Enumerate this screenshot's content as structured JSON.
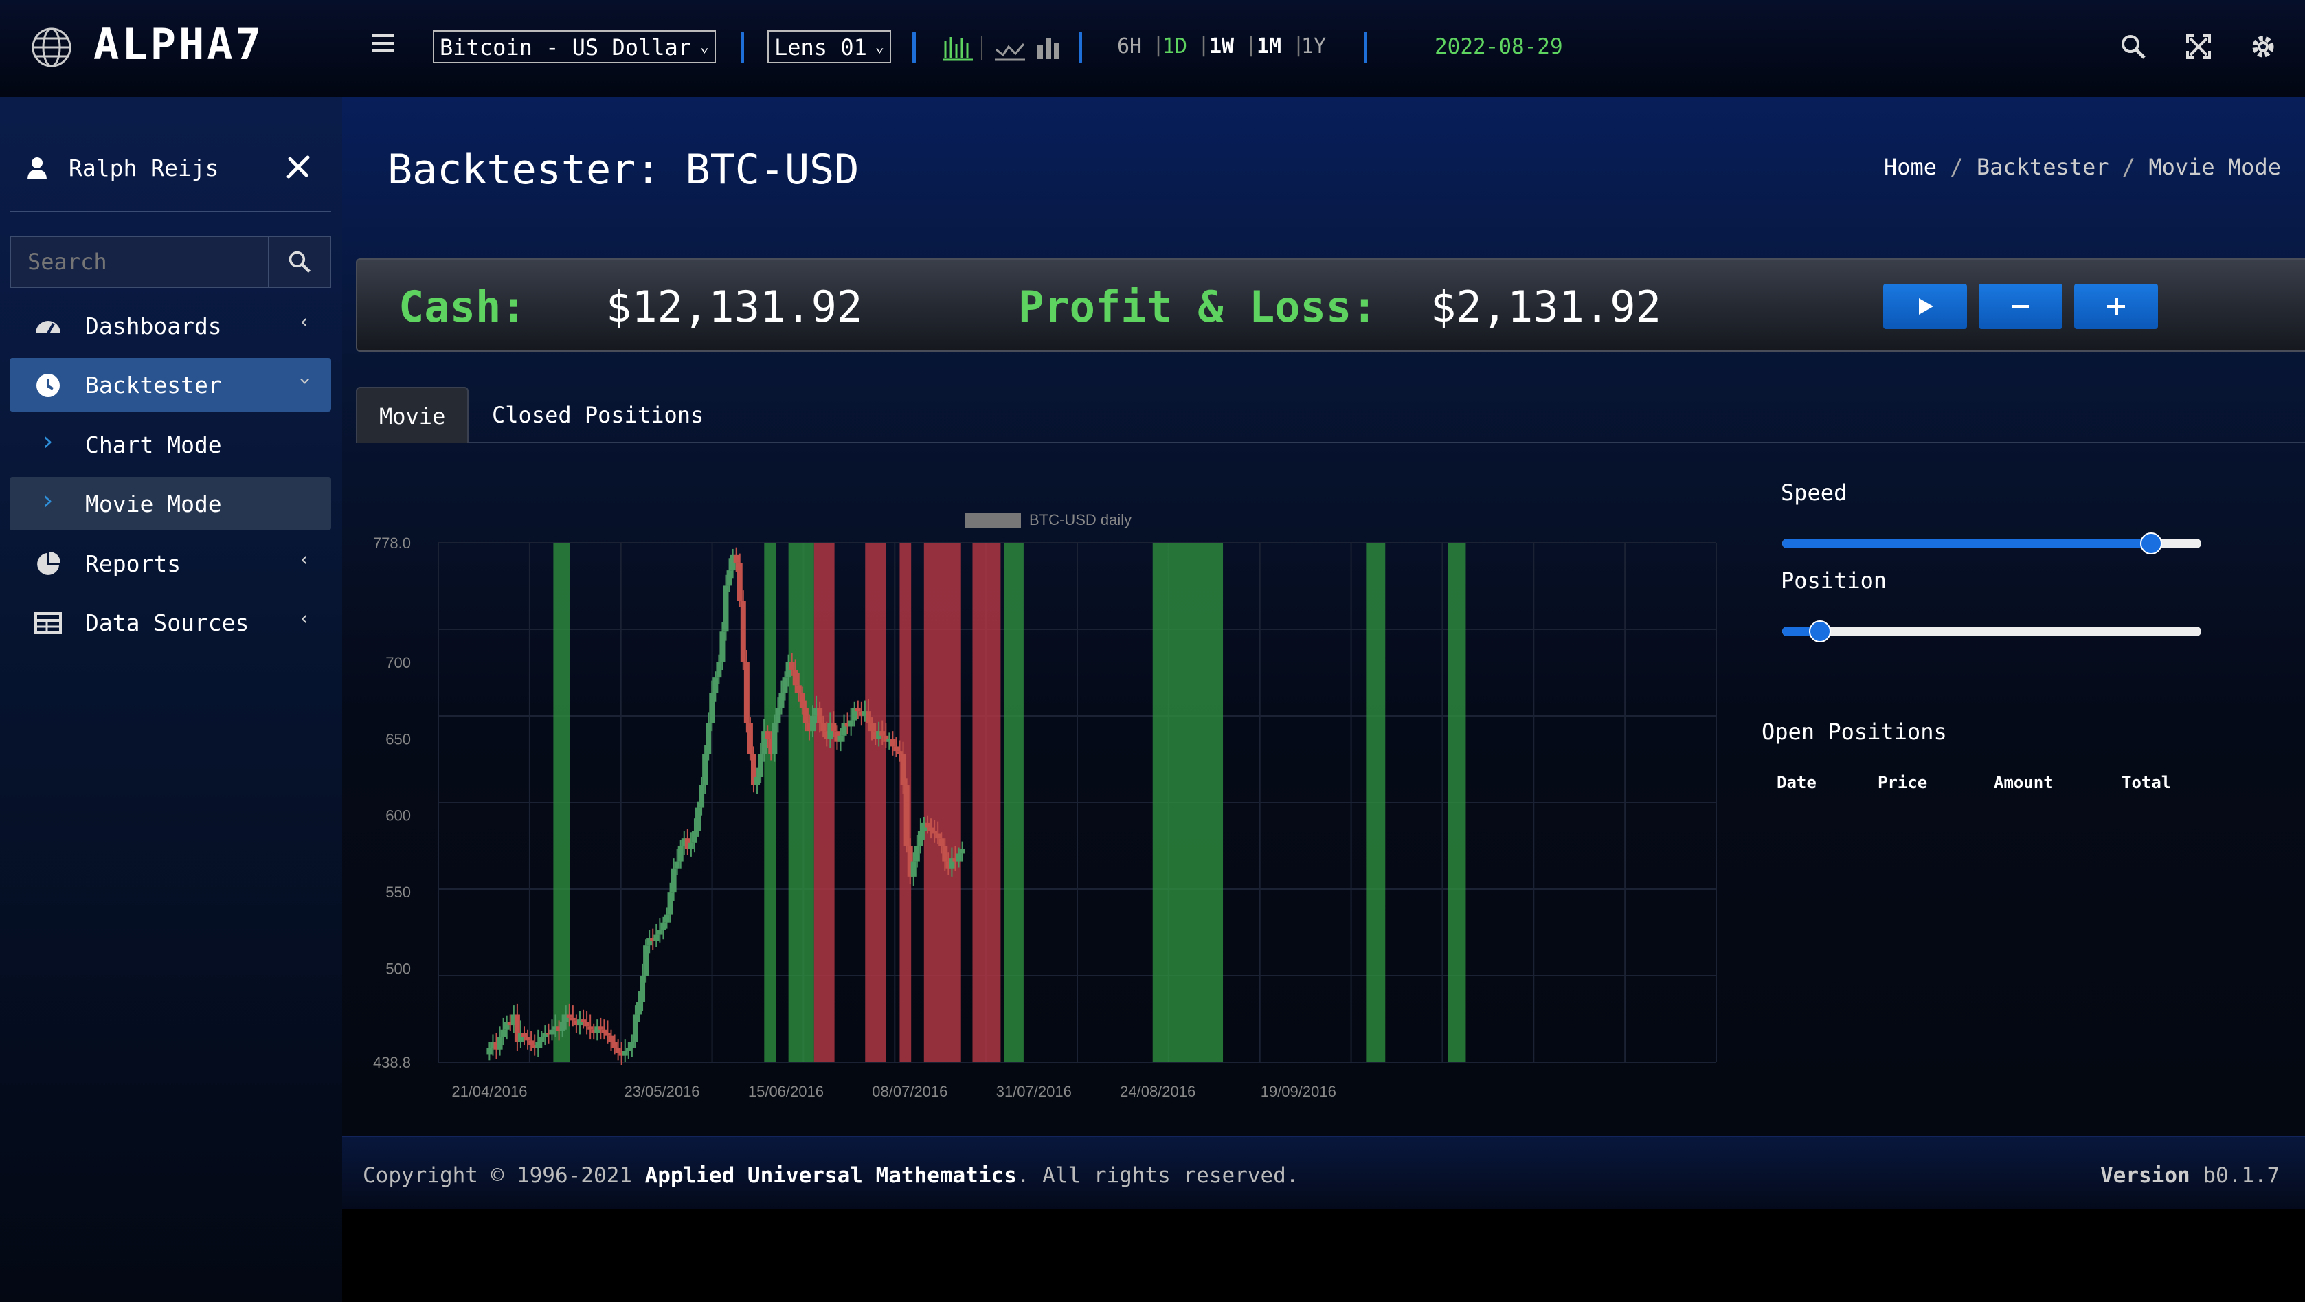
{
  "app": {
    "logo": "ALPHA7"
  },
  "toolbar": {
    "instrument": "Bitcoin - US Dollar",
    "lens": "Lens 01",
    "timeframes": [
      "6H",
      "1D",
      "1W",
      "1M",
      "1Y"
    ],
    "date": "2022-08-29"
  },
  "sidebar": {
    "user": "Ralph Reijs",
    "search_placeholder": "Search",
    "items": [
      {
        "label": "Dashboards"
      },
      {
        "label": "Backtester"
      },
      {
        "label": "Chart Mode"
      },
      {
        "label": "Movie Mode"
      },
      {
        "label": "Reports"
      },
      {
        "label": "Data Sources"
      }
    ]
  },
  "page": {
    "title": "Backtester: BTC-USD",
    "breadcrumb": {
      "home": "Home",
      "section": "Backtester",
      "current": "Movie Mode",
      "sep": "/"
    }
  },
  "stats": {
    "cash_label": "Cash:",
    "cash_value": "$12,131.92",
    "pnl_label": "Profit & Loss:",
    "pnl_value": "$2,131.92"
  },
  "tabs": [
    {
      "label": "Movie"
    },
    {
      "label": "Closed Positions"
    }
  ],
  "controls": {
    "speed_label": "Speed",
    "speed_value": 0.88,
    "position_label": "Position",
    "position_value": 0.09
  },
  "open_positions": {
    "title": "Open Positions",
    "columns": [
      "Date",
      "Price",
      "Amount",
      "Total"
    ]
  },
  "footer": {
    "copyright_prefix": "Copyright © 1996-2021",
    "company": "Applied Universal Mathematics",
    "suffix": ". All rights reserved.",
    "version_label": "Version",
    "version": "b0.1.7"
  },
  "colors": {
    "accent": "#1f6fd8",
    "positive": "#5fd35f",
    "buy": "#2e8b3e",
    "sell": "#b53845"
  },
  "chart_data": {
    "type": "candlestick",
    "legend": "BTC-USD daily",
    "ylim": [
      438.8,
      778.0
    ],
    "yticks": [
      "778.0",
      "700",
      "650",
      "600",
      "550",
      "500",
      "438.8"
    ],
    "xticks": [
      "21/04/2016",
      "23/05/2016",
      "15/06/2016",
      "08/07/2016",
      "31/07/2016",
      "24/08/2016",
      "19/09/2016"
    ],
    "bands": [
      {
        "x0": 0.09,
        "x1": 0.103,
        "type": "buy"
      },
      {
        "x0": 0.255,
        "x1": 0.264,
        "type": "buy"
      },
      {
        "x0": 0.274,
        "x1": 0.294,
        "type": "buy"
      },
      {
        "x0": 0.294,
        "x1": 0.31,
        "type": "sell"
      },
      {
        "x0": 0.334,
        "x1": 0.35,
        "type": "sell"
      },
      {
        "x0": 0.361,
        "x1": 0.37,
        "type": "sell"
      },
      {
        "x0": 0.38,
        "x1": 0.409,
        "type": "sell"
      },
      {
        "x0": 0.418,
        "x1": 0.44,
        "type": "sell"
      },
      {
        "x0": 0.443,
        "x1": 0.458,
        "type": "buy"
      },
      {
        "x0": 0.559,
        "x1": 0.614,
        "type": "buy"
      },
      {
        "x0": 0.726,
        "x1": 0.741,
        "type": "buy"
      },
      {
        "x0": 0.79,
        "x1": 0.804,
        "type": "buy"
      }
    ],
    "closes": [
      448,
      452,
      447,
      455,
      460,
      465,
      463,
      470,
      452,
      458,
      455,
      453,
      450,
      448,
      452,
      455,
      458,
      457,
      460,
      462,
      459,
      465,
      470,
      468,
      466,
      463,
      467,
      465,
      462,
      460,
      458,
      462,
      460,
      458,
      456,
      452,
      448,
      445,
      443,
      446,
      448,
      452,
      470,
      478,
      495,
      515,
      520,
      518,
      522,
      525,
      530,
      535,
      550,
      565,
      570,
      580,
      585,
      578,
      582,
      590,
      605,
      620,
      640,
      660,
      680,
      690,
      700,
      720,
      750,
      760,
      770,
      765,
      740,
      700,
      660,
      640,
      620,
      625,
      640,
      655,
      650,
      640,
      660,
      670,
      680,
      690,
      700,
      695,
      685,
      680,
      670,
      660,
      655,
      665,
      670,
      660,
      655,
      650,
      660,
      655,
      648,
      652,
      660,
      658,
      662,
      670,
      668,
      665,
      668,
      660,
      655,
      650,
      655,
      652,
      648,
      650,
      645,
      642,
      640,
      620,
      580,
      560,
      570,
      580,
      590,
      595,
      592,
      590,
      588,
      585,
      580,
      570,
      565,
      572,
      570,
      575,
      578
    ]
  }
}
